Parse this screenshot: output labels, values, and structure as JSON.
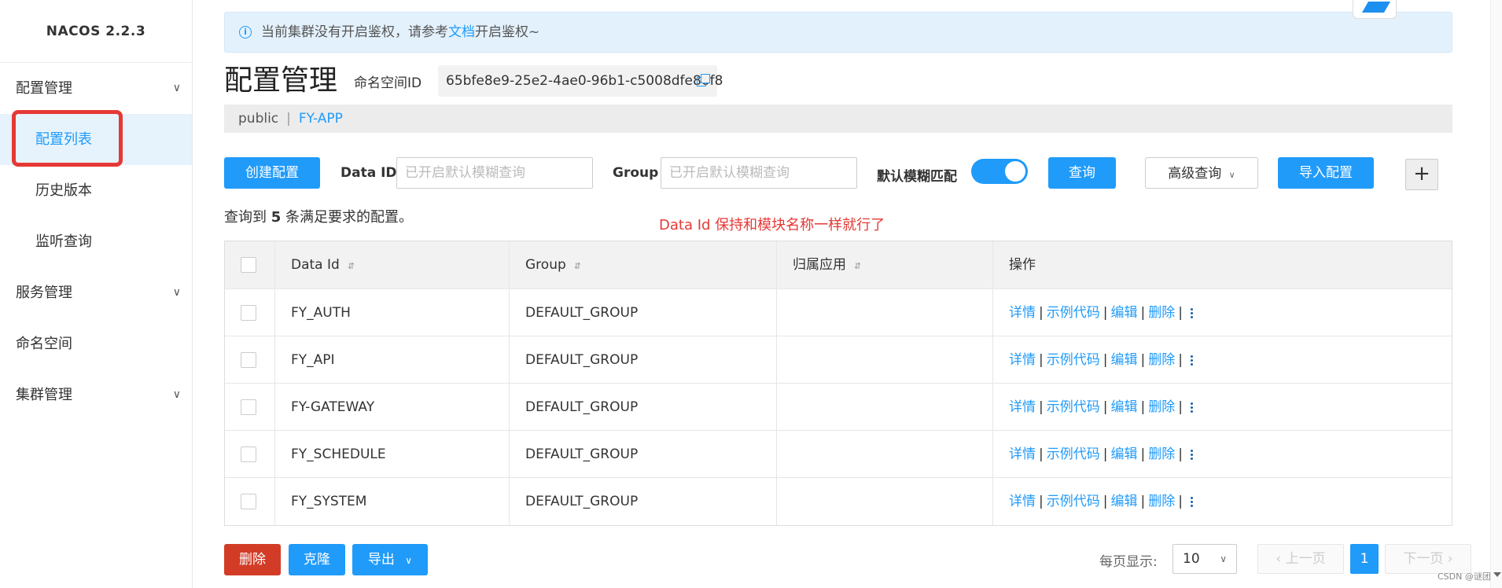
{
  "brand": "NACOS 2.2.3",
  "sidebar": {
    "groups": [
      {
        "label": "配置管理"
      },
      {
        "label": "服务管理"
      },
      {
        "label": "命名空间"
      },
      {
        "label": "集群管理"
      }
    ],
    "config_items": [
      {
        "label": "配置列表"
      },
      {
        "label": "历史版本"
      },
      {
        "label": "监听查询"
      }
    ]
  },
  "notice": {
    "text_before": "当前集群没有开启鉴权，请参考",
    "link": "文档",
    "text_after": "开启鉴权~"
  },
  "header": {
    "title": "配置管理",
    "namespace_label": "命名空间ID",
    "namespace_id": "65bfe8e9-25e2-4ae0-96b1-c5008dfe86f8"
  },
  "namespace_tabs": [
    "public",
    "FY-APP"
  ],
  "namespace_sep": "|",
  "toolbar": {
    "create_label": "创建配置",
    "dataid_label": "Data ID",
    "dataid_placeholder": "已开启默认模糊查询",
    "group_label": "Group",
    "group_placeholder": "已开启默认模糊查询",
    "fuzzy_label": "默认模糊匹配",
    "query_label": "查询",
    "advanced_label": "高级查询",
    "import_label": "导入配置"
  },
  "summary": {
    "prefix": "查询到",
    "count": "5",
    "suffix": "条满足要求的配置。"
  },
  "annotation": "Data Id 保持和模块名称一样就行了",
  "table": {
    "headers": {
      "dataid": "Data Id",
      "group": "Group",
      "app": "归属应用",
      "ops": "操作"
    },
    "rows": [
      {
        "dataid": "FY_AUTH",
        "group": "DEFAULT_GROUP",
        "app": ""
      },
      {
        "dataid": "FY_API",
        "group": "DEFAULT_GROUP",
        "app": ""
      },
      {
        "dataid": "FY-GATEWAY",
        "group": "DEFAULT_GROUP",
        "app": ""
      },
      {
        "dataid": "FY_SCHEDULE",
        "group": "DEFAULT_GROUP",
        "app": ""
      },
      {
        "dataid": "FY_SYSTEM",
        "group": "DEFAULT_GROUP",
        "app": ""
      }
    ],
    "ops": {
      "detail": "详情",
      "sample": "示例代码",
      "edit": "编辑",
      "delete": "删除",
      "sep": "|"
    }
  },
  "footer": {
    "delete_label": "删除",
    "clone_label": "克隆",
    "export_label": "导出",
    "page_size_label": "每页显示:",
    "page_size": "10",
    "prev_label": "上一页",
    "current_page": "1",
    "next_label": "下一页"
  },
  "watermark": "CSDN @谜团",
  "colors": {
    "primary": "#209bfa",
    "danger": "#d23c26",
    "annotation": "#e53935"
  }
}
